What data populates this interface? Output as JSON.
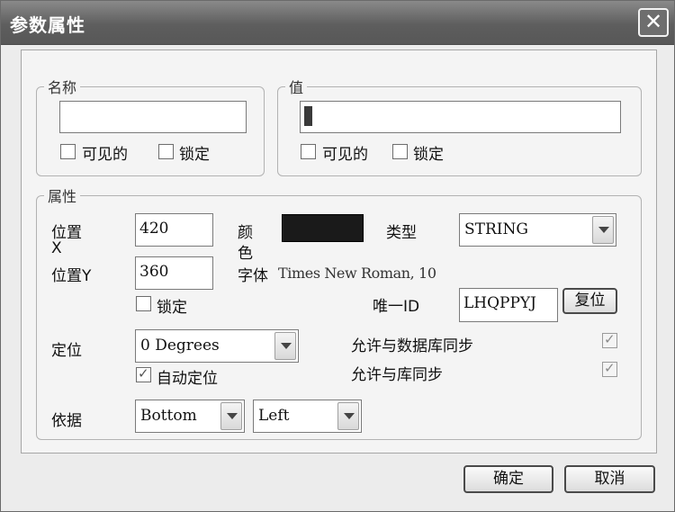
{
  "window": {
    "title": "参数属性",
    "close_symbol": "✕"
  },
  "name_group": {
    "legend": "名称",
    "value": "",
    "visible_label": "可见的",
    "lock_label": "锁定"
  },
  "value_group": {
    "legend": "值",
    "value": "",
    "visible_label": "可见的",
    "lock_label": "锁定"
  },
  "props": {
    "legend": "属性",
    "pos_x_label_1": "位置",
    "pos_x_label_2": "X",
    "pos_x_value": "420",
    "pos_y_label": "位置Y",
    "pos_y_value": "360",
    "pos_lock_label": "锁定",
    "color_label_1": "颜",
    "color_label_2": "色",
    "color_value": "#1a1a1a",
    "font_label": "字体",
    "font_value": "Times New Roman, 10",
    "type_label": "类型",
    "type_value": "STRING",
    "uid_label": "唯一ID",
    "uid_value": "LHQPPYJ",
    "reset_button": "复位",
    "orient_label": "定位",
    "orient_value": "0 Degrees",
    "auto_orient_label": "自动定位",
    "sync_db_label": "允许与数据库同步",
    "sync_lib_label": "允许与库同步",
    "justify_label": "依据",
    "justify_v_value": "Bottom",
    "justify_h_value": "Left"
  },
  "footer": {
    "ok_button": "确定",
    "cancel_button": "取消"
  }
}
